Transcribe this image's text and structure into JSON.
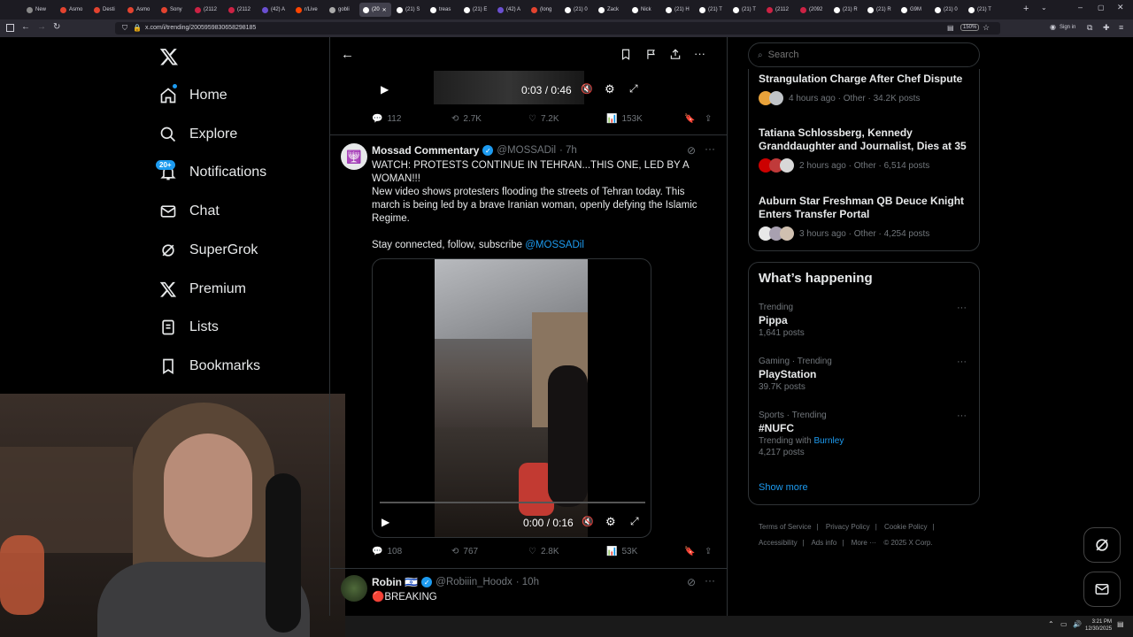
{
  "browser": {
    "tabs": [
      "New",
      "Asmo",
      "Desti",
      "Asmo",
      "Sony",
      "(2112",
      "(2112",
      "(42) A",
      "r/Live",
      "gobli",
      "(20",
      "(21) S",
      "treas",
      "(21) E",
      "(42) A",
      "(long",
      "(21) 0",
      "Zack",
      "Nick",
      "(21) H",
      "(21) T",
      "(21) T",
      "(2112",
      "(2092",
      "(21) R",
      "(21) R",
      "G9M",
      "(21) 0",
      "(21) T"
    ],
    "url": "x.com/i/trending/2005959830658298185",
    "zoom": "150%",
    "signin": "Sign in"
  },
  "sidebar": {
    "items": [
      {
        "label": "Home"
      },
      {
        "label": "Explore"
      },
      {
        "label": "Notifications",
        "badge": "20+"
      },
      {
        "label": "Chat"
      },
      {
        "label": "SuperGrok"
      },
      {
        "label": "Premium"
      },
      {
        "label": "Lists"
      },
      {
        "label": "Bookmarks"
      }
    ]
  },
  "feed": {
    "top_video": {
      "time": "0:03 / 0:46"
    },
    "top_stats": {
      "replies": "112",
      "reposts": "2.7K",
      "likes": "7.2K",
      "views": "153K"
    },
    "tweet1": {
      "name": "Mossad Commentary",
      "handle": "@MOSSADil",
      "time": "· 7h",
      "line1": "WATCH: PROTESTS CONTINUE IN TEHRAN...THIS ONE, LED BY A WOMAN!!!",
      "line2": "New video shows protesters flooding the streets of Tehran today. This march is being led by a brave Iranian woman, openly defying the Islamic Regime.",
      "line3_prefix": "Stay connected, follow, subscribe ",
      "line3_link": "@MOSSADil",
      "video_time": "0:00 / 0:16",
      "video_progress": 0.0,
      "stats": {
        "replies": "108",
        "reposts": "767",
        "likes": "2.8K",
        "views": "53K"
      }
    },
    "tweet2": {
      "name": "Robin 🇮🇱",
      "handle": "@Robiiin_Hoodx",
      "time": "· 10h",
      "text": "🔴BREAKING"
    }
  },
  "right": {
    "search_placeholder": "Search",
    "news": [
      {
        "title": "Strangulation Charge After Chef Dispute",
        "meta": "4 hours ago · Other · 34.2K posts"
      },
      {
        "title": "Tatiana Schlossberg, Kennedy Granddaughter and Journalist, Dies at 35",
        "meta": "2 hours ago · Other · 6,514 posts"
      },
      {
        "title": "Auburn Star Freshman QB Deuce Knight Enters Transfer Portal",
        "meta": "3 hours ago · Other · 4,254 posts"
      }
    ],
    "happening_title": "What’s happening",
    "trends": [
      {
        "context": "Trending",
        "name": "Pippa",
        "posts": "1,641 posts"
      },
      {
        "context": "Gaming · Trending",
        "name": "PlayStation",
        "posts": "39.7K posts"
      },
      {
        "context": "Sports · Trending",
        "name": "#NUFC",
        "with_prefix": "Trending with ",
        "with_link": "Burnley",
        "posts": "4,217 posts"
      }
    ],
    "show_more": "Show more",
    "footer": [
      "Terms of Service",
      "Privacy Policy",
      "Cookie Policy",
      "Accessibility",
      "Ads info",
      "More ···",
      "© 2025 X Corp."
    ]
  },
  "taskbar": {
    "time": "3:21 PM",
    "date": "12/30/2025"
  },
  "colors": {
    "accent": "#1d9bf0",
    "bg": "#000000",
    "border": "#2f3336",
    "muted": "#71767b"
  }
}
